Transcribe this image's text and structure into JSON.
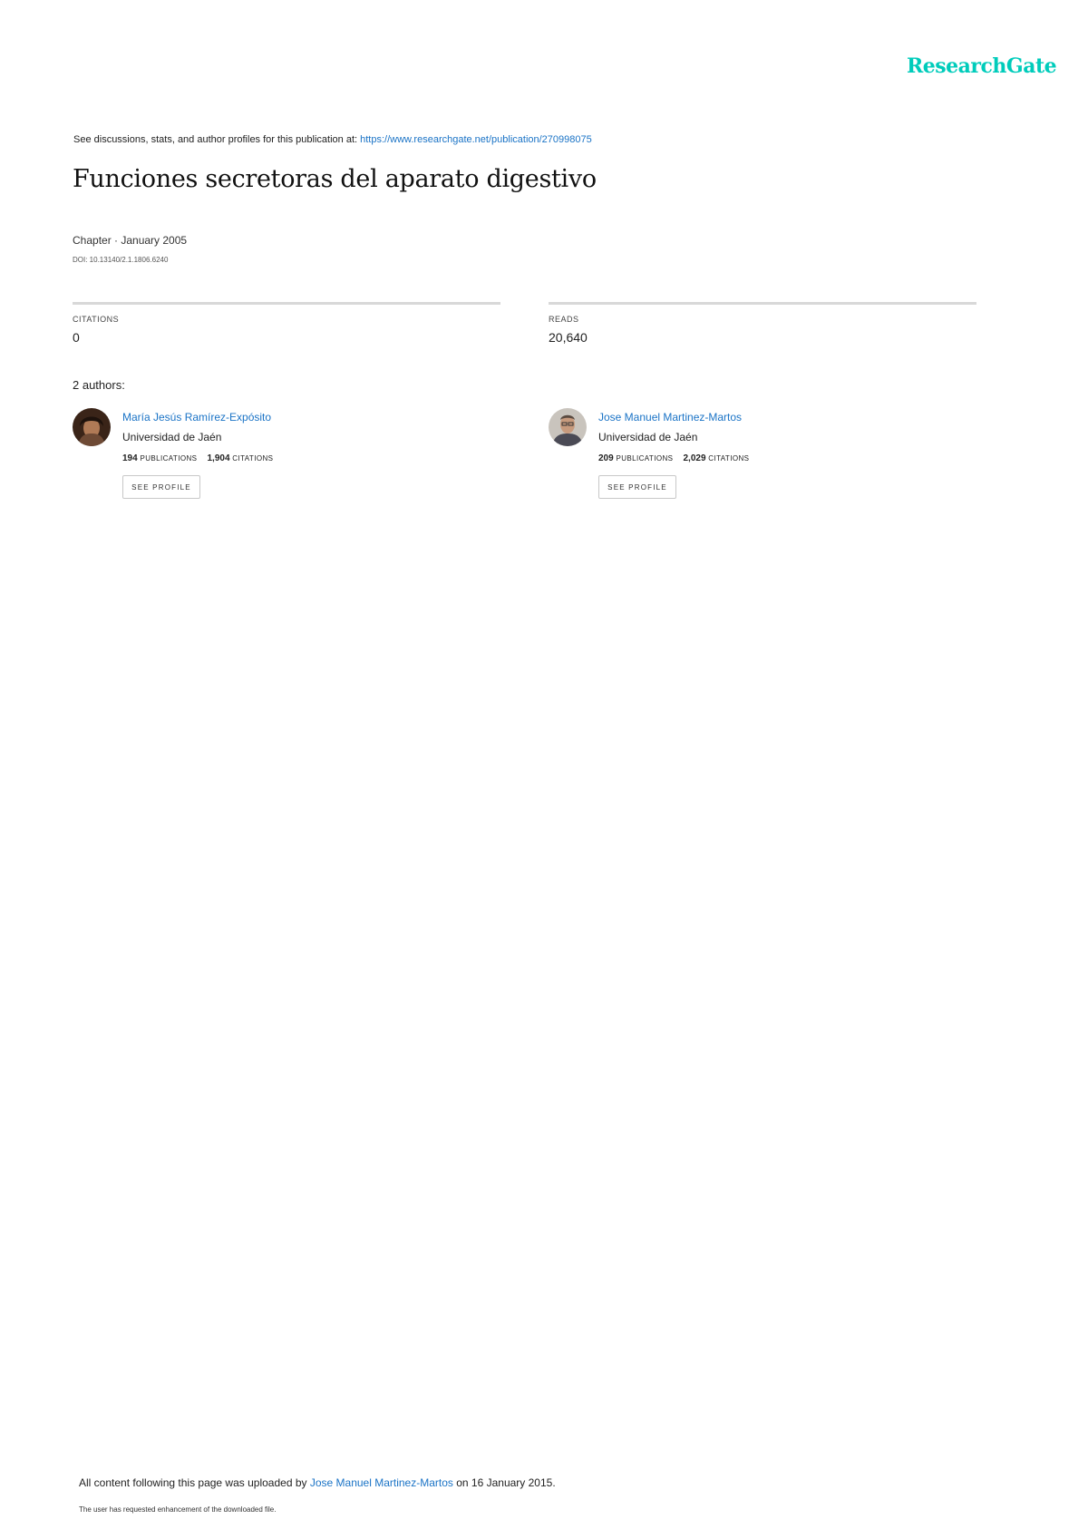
{
  "header": {
    "logo_text": "ResearchGate",
    "discussion_prefix": "See discussions, stats, and author profiles for this publication at: ",
    "discussion_url": "https://www.researchgate.net/publication/270998075"
  },
  "publication": {
    "title": "Funciones secretoras del aparato digestivo",
    "meta": "Chapter · January 2005",
    "doi": "DOI: 10.13140/2.1.1806.6240"
  },
  "stats": {
    "citations_label": "CITATIONS",
    "citations_value": "0",
    "reads_label": "READS",
    "reads_value": "20,640"
  },
  "authors_heading": "2 authors:",
  "authors": [
    {
      "name": "María Jesús Ramírez-Expósito",
      "institution": "Universidad de Jaén",
      "publications": "194",
      "publications_label": "PUBLICATIONS",
      "citations": "1,904",
      "citations_label": "CITATIONS",
      "button_label": "SEE PROFILE"
    },
    {
      "name": "Jose Manuel Martinez-Martos",
      "institution": "Universidad de Jaén",
      "publications": "209",
      "publications_label": "PUBLICATIONS",
      "citations": "2,029",
      "citations_label": "CITATIONS",
      "button_label": "SEE PROFILE"
    }
  ],
  "footer": {
    "upload_prefix": "All content following this page was uploaded by ",
    "upload_author": "Jose Manuel Martinez-Martos",
    "upload_suffix": " on 16 January 2015.",
    "note": "The user has requested enhancement of the downloaded file."
  },
  "colors": {
    "logo": "#00ccbb",
    "link": "#1a73c6",
    "rule": "#d8d8d8"
  }
}
